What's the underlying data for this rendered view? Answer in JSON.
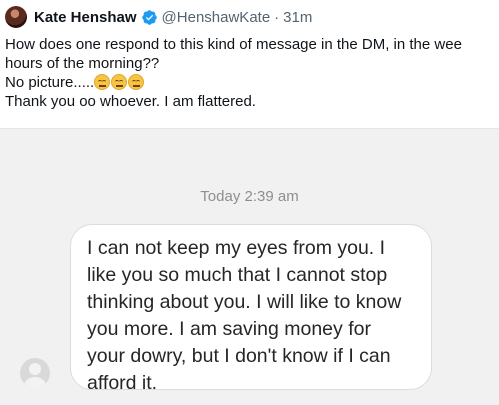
{
  "tweet": {
    "author": {
      "display_name": "Kate Henshaw",
      "handle": "@HenshawKate",
      "separator": "·",
      "time": "31m",
      "verified_icon": "verified-badge-icon",
      "verified_color": "#1d9bf0"
    },
    "text_lines": [
      "How does one respond to this kind of message in the DM, in the wee",
      "hours of the morning??",
      "No picture.....",
      "Thank you oo whoever. I am flattered."
    ],
    "emojis": [
      "downcast-face-icon",
      "downcast-face-icon",
      "downcast-face-icon"
    ]
  },
  "dm_screenshot": {
    "timestamp": "Today 2:39 am",
    "message_lines": [
      "I can not keep my eyes from you. I",
      "like you so much that I cannot stop",
      "thinking about you. I will like to know",
      "you more. I am saving money for",
      "your dowry, but I don't know if I can",
      "afford it."
    ],
    "sender_avatar_icon": "default-avatar-icon"
  }
}
